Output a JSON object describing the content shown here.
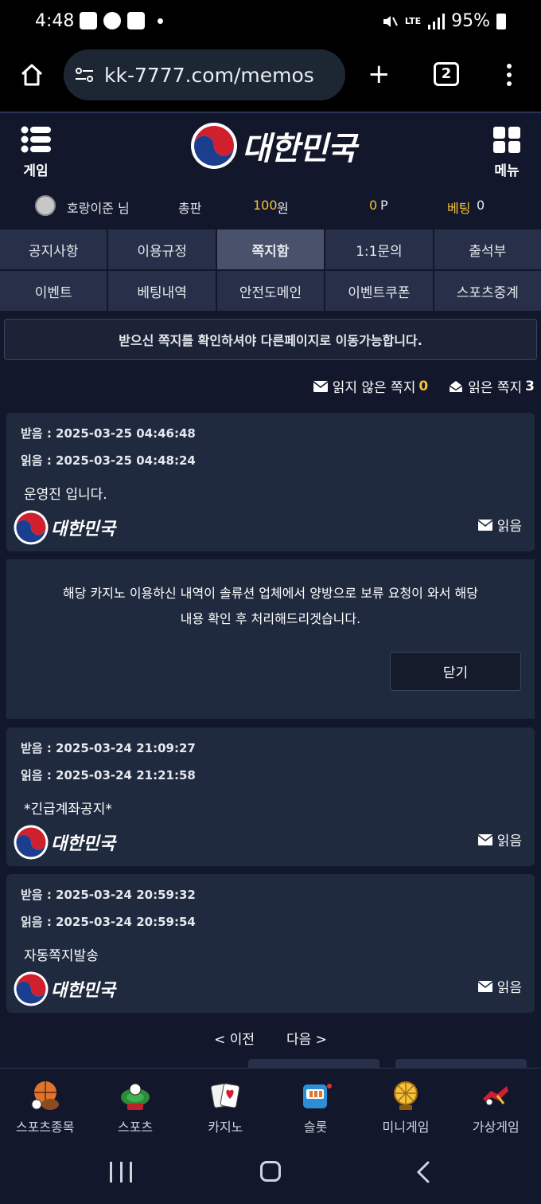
{
  "status_bar": {
    "time": "4:48",
    "battery": "95%",
    "network": "LTE"
  },
  "browser": {
    "url": "kk-7777.com/memos",
    "tab_count": "2"
  },
  "header": {
    "game_label": "게임",
    "menu_label": "메뉴",
    "logo_text": "대한민국"
  },
  "user": {
    "name": "호랑이준 님",
    "role": "총판",
    "money": "100",
    "money_unit": "원",
    "points": "0",
    "points_unit": "P",
    "bet_label": "베팅",
    "bet_value": "0"
  },
  "nav": [
    {
      "label": "공지사항"
    },
    {
      "label": "이용규정"
    },
    {
      "label": "쪽지함"
    },
    {
      "label": "1:1문의"
    },
    {
      "label": "출석부"
    },
    {
      "label": "이벤트"
    },
    {
      "label": "베팅내역"
    },
    {
      "label": "안전도메인"
    },
    {
      "label": "이벤트쿠폰"
    },
    {
      "label": "스포츠중계"
    }
  ],
  "notice": "받으신 쪽지를 확인하셔야 다른페이지로 이동가능합니다.",
  "counters": {
    "unread_label": "읽지 않은 쪽지",
    "unread_count": "0",
    "read_label": "읽은 쪽지",
    "read_count": "3"
  },
  "memos": [
    {
      "received": "받음 : 2025-03-25 04:46:48",
      "read": "읽음 : 2025-03-25 04:48:24",
      "title": "운영진 입니다.",
      "status": "읽음"
    },
    {
      "received": "받음 : 2025-03-24 21:09:27",
      "read": "읽음 : 2025-03-24 21:21:58",
      "title": "*긴급계좌공지*",
      "status": "읽음"
    },
    {
      "received": "받음 : 2025-03-24 20:59:32",
      "read": "읽음 : 2025-03-24 20:59:54",
      "title": "자동쪽지발송",
      "status": "읽음"
    }
  ],
  "memo_body": {
    "line1": "해당 카지노 이용하신 내역이 솔류션 업체에서 양방으로 보류 요청이 와서 해당",
    "line2": "내용 확인 후 처리해드리겟습니다.",
    "close_label": "닫기"
  },
  "pager": {
    "prev": "< 이전",
    "next": "다음 >"
  },
  "bottom_nav": [
    {
      "label": "스포츠종목",
      "icon": "sports-balls-icon"
    },
    {
      "label": "스포츠",
      "icon": "stadium-icon"
    },
    {
      "label": "카지노",
      "icon": "cards-icon"
    },
    {
      "label": "슬롯",
      "icon": "slot-machine-icon"
    },
    {
      "label": "미니게임",
      "icon": "wheel-icon"
    },
    {
      "label": "가상게임",
      "icon": "racing-icon"
    }
  ],
  "colors": {
    "accent_yellow": "#f5c03b",
    "background": "#12172b",
    "card": "#202a3f",
    "nav_active": "#49526a"
  }
}
